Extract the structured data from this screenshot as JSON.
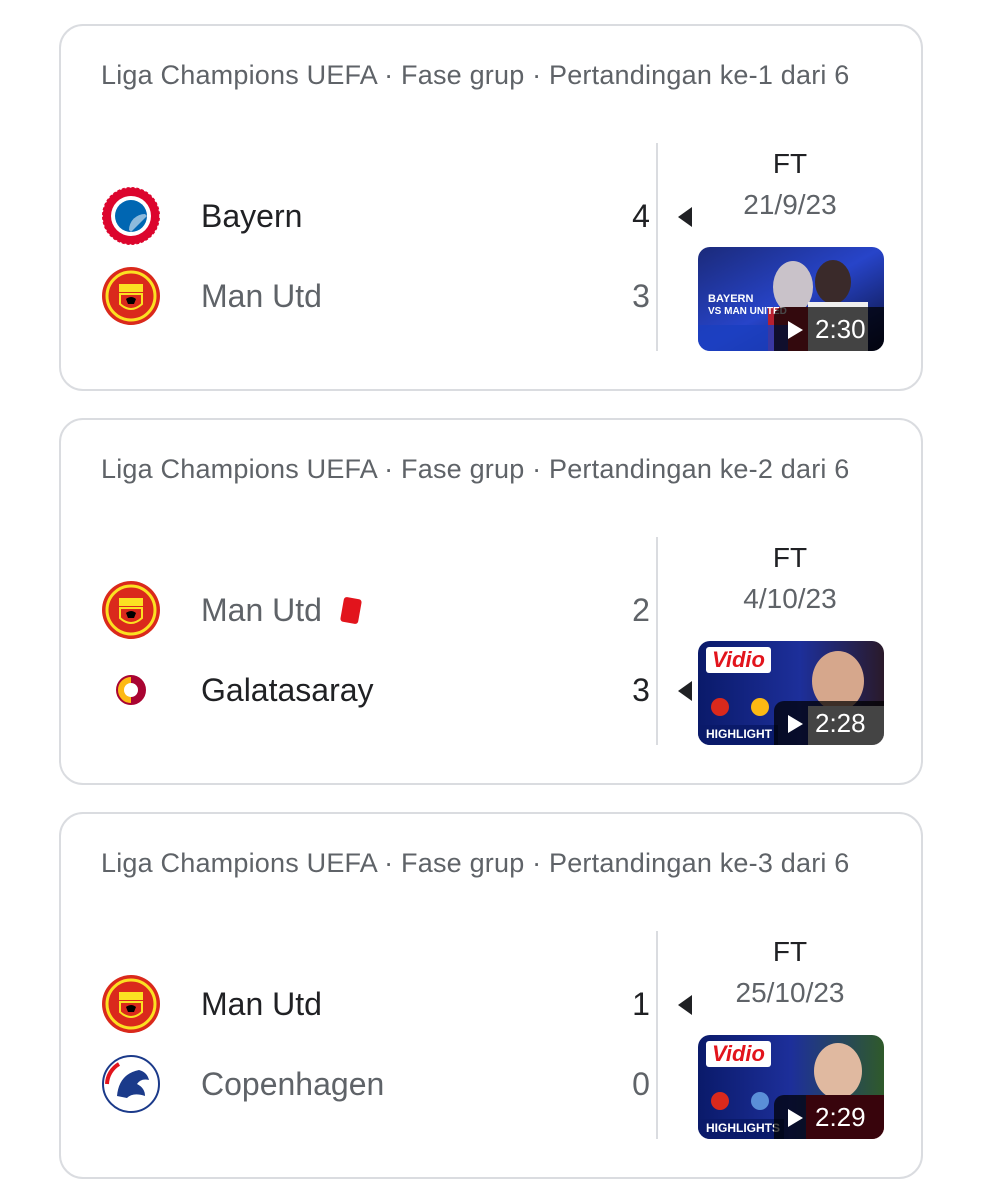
{
  "matches": [
    {
      "competition": "Liga Champions UEFA · Fase grup · Pertandingan ke-1 dari 6",
      "home": {
        "name": "Bayern",
        "score": "4",
        "crest": "bayern-crest"
      },
      "away": {
        "name": "Man Utd",
        "score": "3",
        "crest": "man-utd-crest"
      },
      "winner": "home",
      "status": "FT",
      "date": "21/9/23",
      "video": {
        "duration": "2:30",
        "caption_line1": "BAYERN",
        "caption_line2": "VS MAN UNITED"
      }
    },
    {
      "competition": "Liga Champions UEFA · Fase grup · Pertandingan ke-2 dari 6",
      "home": {
        "name": "Man Utd",
        "score": "2",
        "crest": "man-utd-crest",
        "red_card": true
      },
      "away": {
        "name": "Galatasaray",
        "score": "3",
        "crest": "galatasaray-crest"
      },
      "winner": "away",
      "status": "FT",
      "date": "4/10/23",
      "video": {
        "duration": "2:28",
        "brand": "Vidio",
        "caption": "HIGHLIGHT"
      }
    },
    {
      "competition": "Liga Champions UEFA · Fase grup · Pertandingan ke-3 dari 6",
      "home": {
        "name": "Man Utd",
        "score": "1",
        "crest": "man-utd-crest"
      },
      "away": {
        "name": "Copenhagen",
        "score": "0",
        "crest": "copenhagen-crest"
      },
      "winner": "home",
      "status": "FT",
      "date": "25/10/23",
      "video": {
        "duration": "2:29",
        "brand": "Vidio",
        "caption": "HIGHLIGHTS"
      }
    }
  ],
  "colors": {
    "winner_text": "#202124",
    "muted_text": "#5f6368",
    "border": "#dadce0",
    "red_card": "#e2141c"
  }
}
